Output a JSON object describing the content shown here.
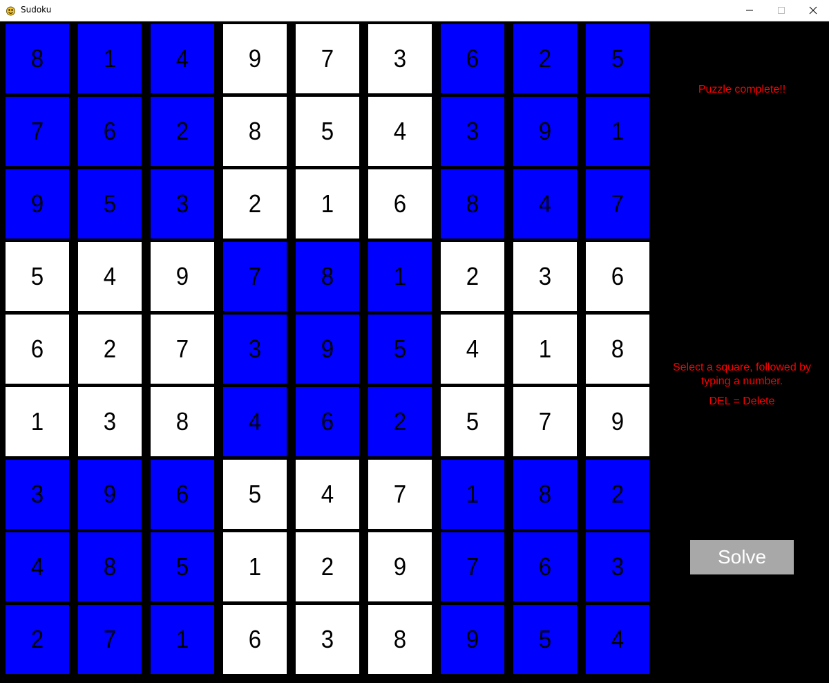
{
  "window": {
    "title": "Sudoku",
    "minimize_glyph": "—",
    "maximize_glyph": "☐",
    "close_glyph": "✕"
  },
  "colors": {
    "fixed_cell": "#0000ff",
    "user_cell": "#ffffff",
    "grid_line": "#000000",
    "message": "#ff0000",
    "button": "#a8a8a8"
  },
  "board": {
    "values": [
      [
        8,
        1,
        4,
        9,
        7,
        3,
        6,
        2,
        5
      ],
      [
        7,
        6,
        2,
        8,
        5,
        4,
        3,
        9,
        1
      ],
      [
        9,
        5,
        3,
        2,
        1,
        6,
        8,
        4,
        7
      ],
      [
        5,
        4,
        9,
        7,
        8,
        1,
        2,
        3,
        6
      ],
      [
        6,
        2,
        7,
        3,
        9,
        5,
        4,
        1,
        8
      ],
      [
        1,
        3,
        8,
        4,
        6,
        2,
        5,
        7,
        9
      ],
      [
        3,
        9,
        6,
        5,
        4,
        7,
        1,
        8,
        2
      ],
      [
        4,
        8,
        5,
        1,
        2,
        9,
        7,
        6,
        3
      ],
      [
        2,
        7,
        1,
        6,
        3,
        8,
        9,
        5,
        4
      ]
    ],
    "blue_boxes": [
      [
        1,
        0,
        1
      ],
      [
        0,
        1,
        0
      ],
      [
        1,
        0,
        1
      ]
    ]
  },
  "sidebar": {
    "status": "Puzzle complete!!",
    "instructions": "Select a square, followed by typing a number.",
    "delete_hint": "DEL = Delete",
    "solve_label": "Solve"
  }
}
